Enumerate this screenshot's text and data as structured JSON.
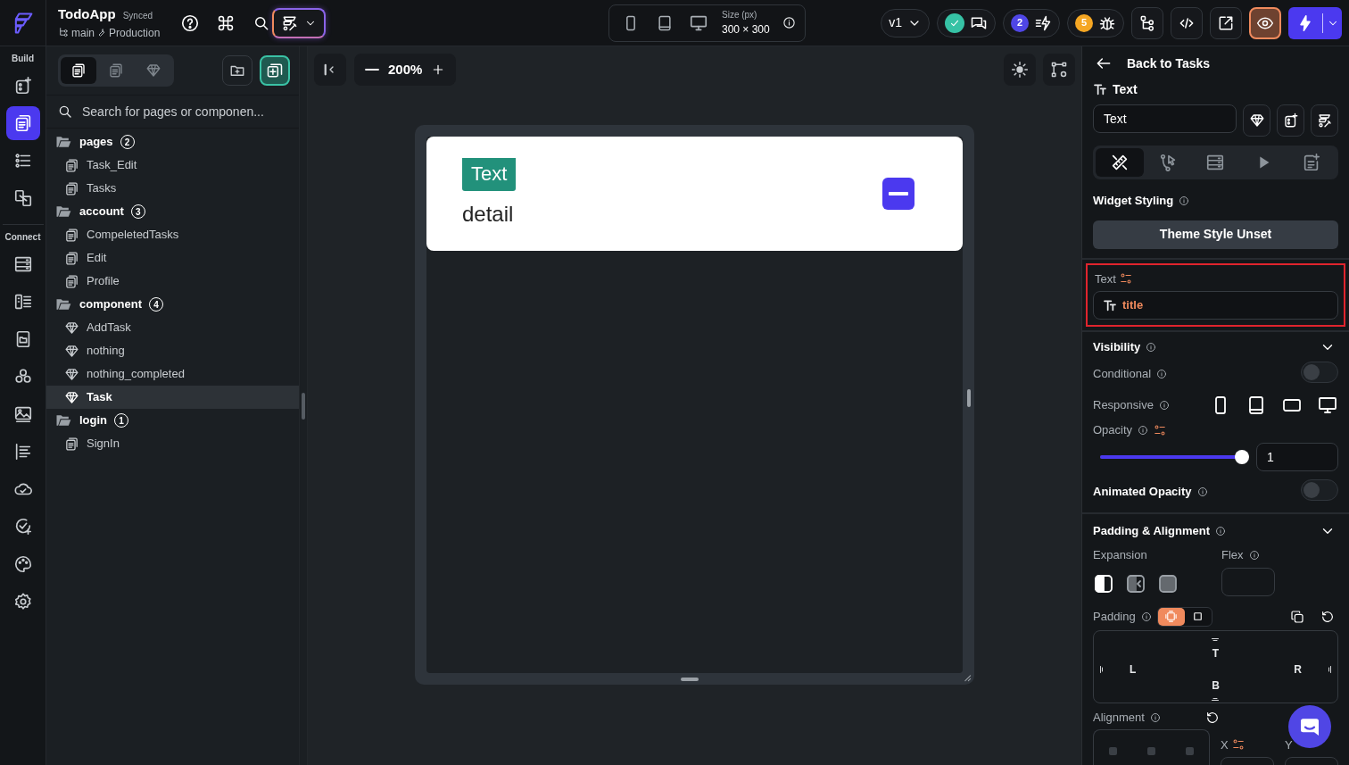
{
  "topbar": {
    "app_name": "TodoApp",
    "sync_status": "Synced",
    "branch": "main",
    "environment": "Production",
    "size_label": "Size (px)",
    "size_value": "300 × 300",
    "version": "v1",
    "counters": [
      {
        "count": "2",
        "color": "#4f46e5"
      },
      {
        "count": "5",
        "color": "#f5a623"
      }
    ]
  },
  "rail": [
    {
      "label": "Build",
      "items": [
        {
          "selected": false
        },
        {
          "selected": true
        },
        {
          "selected": false
        },
        {
          "selected": false
        }
      ]
    },
    {
      "label": "Connect",
      "items": [
        {
          "selected": false
        },
        {
          "selected": false
        },
        {
          "selected": false
        },
        {
          "selected": false
        },
        {
          "selected": false
        },
        {
          "selected": false
        },
        {
          "selected": false
        },
        {
          "selected": false
        },
        {
          "selected": false
        },
        {
          "selected": false
        }
      ]
    }
  ],
  "sidebar": {
    "tabs": [
      {
        "selected": true
      },
      {
        "selected": false
      },
      {
        "selected": false
      }
    ],
    "search": {
      "placeholder": "Search for pages or componen..."
    },
    "tree": [
      {
        "name": "pages",
        "count": "2",
        "children": [
          {
            "name": "Task_Edit",
            "kind": "page",
            "selected": false
          },
          {
            "name": "Tasks",
            "kind": "page",
            "selected": false
          }
        ]
      },
      {
        "name": "account",
        "count": "3",
        "children": [
          {
            "name": "CompeletedTasks",
            "kind": "page",
            "selected": false
          },
          {
            "name": "Edit",
            "kind": "page",
            "selected": false
          },
          {
            "name": "Profile",
            "kind": "page",
            "selected": false
          }
        ]
      },
      {
        "name": "component",
        "count": "4",
        "children": [
          {
            "name": "AddTask",
            "kind": "component",
            "selected": false
          },
          {
            "name": "nothing",
            "kind": "component",
            "selected": false
          },
          {
            "name": "nothing_completed",
            "kind": "component",
            "selected": false
          },
          {
            "name": "Task",
            "kind": "component",
            "selected": true
          }
        ]
      },
      {
        "name": "login",
        "count": "1",
        "children": [
          {
            "name": "SignIn",
            "kind": "page",
            "selected": false
          }
        ]
      }
    ]
  },
  "canvas": {
    "zoom": "200%",
    "preview": {
      "tag": "Text",
      "text": "detail"
    }
  },
  "properties": {
    "back": "Back to Tasks",
    "widget_type": "Text",
    "name_value": "Text",
    "tabs": [
      {
        "selected": true
      },
      {
        "selected": false
      },
      {
        "selected": false
      },
      {
        "selected": false
      },
      {
        "selected": false
      }
    ],
    "styling_label": "Widget Styling",
    "theme_button": "Theme Style Unset",
    "text_field": {
      "label": "Text",
      "value": "title",
      "highlighted": true
    },
    "visibility": {
      "title": "Visibility",
      "conditional_label": "Conditional",
      "conditional_on": false,
      "responsive_label": "Responsive",
      "devices": [
        {
          "on": true
        },
        {
          "on": true
        },
        {
          "on": true
        },
        {
          "on": true
        }
      ],
      "opacity_label": "Opacity",
      "opacity": {
        "level": 1,
        "value": "1"
      },
      "animated_label": "Animated Opacity",
      "animated_on": false
    },
    "layout": {
      "title": "Padding & Alignment",
      "expansion_label": "Expansion",
      "expansion": [
        {
          "selected": true
        },
        {
          "selected": false
        },
        {
          "selected": false
        }
      ],
      "flex_label": "Flex",
      "padding_label": "Padding",
      "padding_modes": [
        {
          "selected": true
        },
        {
          "selected": false
        }
      ],
      "sides": [
        "T",
        "L",
        "R",
        "B"
      ],
      "alignment_label": "Alignment",
      "x_label": "X",
      "y_label": "Y"
    }
  }
}
